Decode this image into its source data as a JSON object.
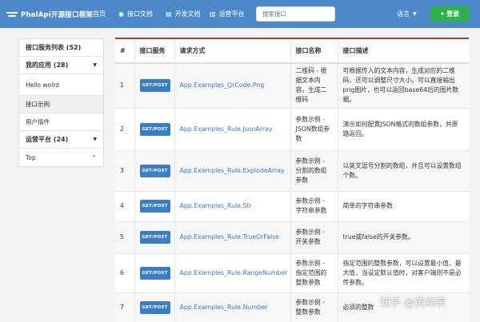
{
  "header": {
    "brand": "PhalApi开源接口框架",
    "nav": [
      {
        "label": "首页",
        "icon": ""
      },
      {
        "label": "接口文档",
        "icon": "globe-icon"
      },
      {
        "label": "开发文档",
        "icon": "file-icon"
      },
      {
        "label": "运营平台",
        "icon": "chart-icon"
      }
    ],
    "search_placeholder": "搜索接口",
    "language": "语言",
    "login": "登录"
  },
  "sidebar": {
    "service_list": "接口服务列表 (52)",
    "my_apps": "我的应用 (28)",
    "items": [
      "Hello wolrd",
      "接口示例",
      "用户插件"
    ],
    "ops_platform": "运营平台 (24)",
    "top": "Top"
  },
  "table": {
    "headers": [
      "#",
      "接口服务",
      "请求方式",
      "接口名称",
      "接口描述"
    ],
    "rows": [
      {
        "num": "1",
        "method": "GET/POST",
        "api": "App.Examples_QrCode.Png",
        "name": "二维码 - 根据文本内容，生成二维码",
        "desc": "可根据传入的文本内容，生成对应的二维码，还可以调整尺寸大小。可以直接输出png图片，也可以返回base64后的图片数据。"
      },
      {
        "num": "2",
        "method": "GET/POST",
        "api": "App.Examples_Rule.JsonArray",
        "name": "参数示例 - JSON数组参数",
        "desc": "演示如何配置JSON格式的数组参数，并原路返回。"
      },
      {
        "num": "3",
        "method": "GET/POST",
        "api": "App.Examples_Rule.ExplodeArray",
        "name": "参数示例 - 分割的数组参数",
        "desc": "以英文逗号分割的数组，并且可以设置数组个数。"
      },
      {
        "num": "4",
        "method": "GET/POST",
        "api": "App.Examples_Rule.Str",
        "name": "参数示例 - 字符串参数",
        "desc": "简单的字符串参数"
      },
      {
        "num": "5",
        "method": "GET/POST",
        "api": "App.Examples_Rule.TrueOrFalse",
        "name": "参数示例 - 开关参数",
        "desc": "true或false的开关参数。"
      },
      {
        "num": "6",
        "method": "GET/POST",
        "api": "App.Examples_Rule.RangeNumber",
        "name": "参数示例 - 指定范围的整数参数",
        "desc": "指定范围的整数参数，可以设置最小值、最大值，当设定默认值时，对客户端则不是必传参数。"
      },
      {
        "num": "7",
        "method": "GET/POST",
        "api": "App.Examples_Rule.Number",
        "name": "参数示例 - 整数参数",
        "desc": "必须的整数"
      }
    ]
  },
  "watermark": "知乎 @黄禅宗"
}
